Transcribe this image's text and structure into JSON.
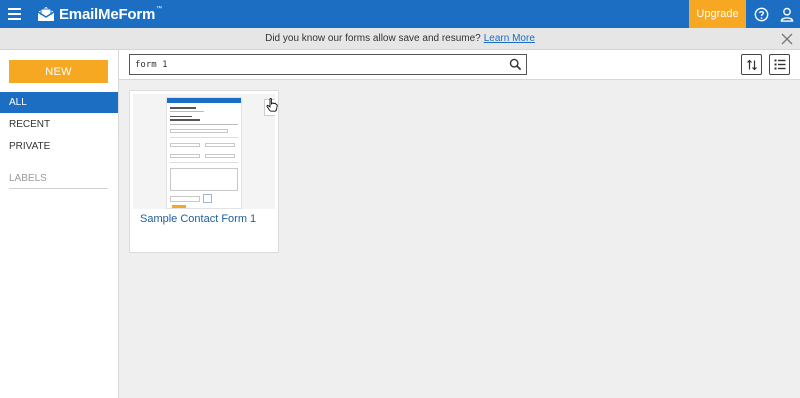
{
  "header": {
    "brand": "EmailMeForm",
    "upgrade_label": "Upgrade",
    "help_icon": "help-circle-icon",
    "user_icon": "user-icon",
    "menu_icon": "hamburger-menu-icon",
    "color": "#1b6ec2",
    "accent": "#f7a823"
  },
  "banner": {
    "message": "Did you know our forms allow save and resume?",
    "link_label": "Learn More",
    "close_icon": "close-icon"
  },
  "sidebar": {
    "new_label": "NEW",
    "items": [
      {
        "label": "ALL",
        "active": true
      },
      {
        "label": "RECENT",
        "active": false
      },
      {
        "label": "PRIVATE",
        "active": false
      }
    ],
    "labels_heading": "LABELS"
  },
  "toolbar": {
    "search_value": "form 1",
    "search_icon": "search-icon",
    "sort_icon": "sort-icon",
    "view_icon": "list-view-icon"
  },
  "forms": [
    {
      "title": "Sample Contact Form 1",
      "gear_icon": "gear-icon"
    }
  ]
}
